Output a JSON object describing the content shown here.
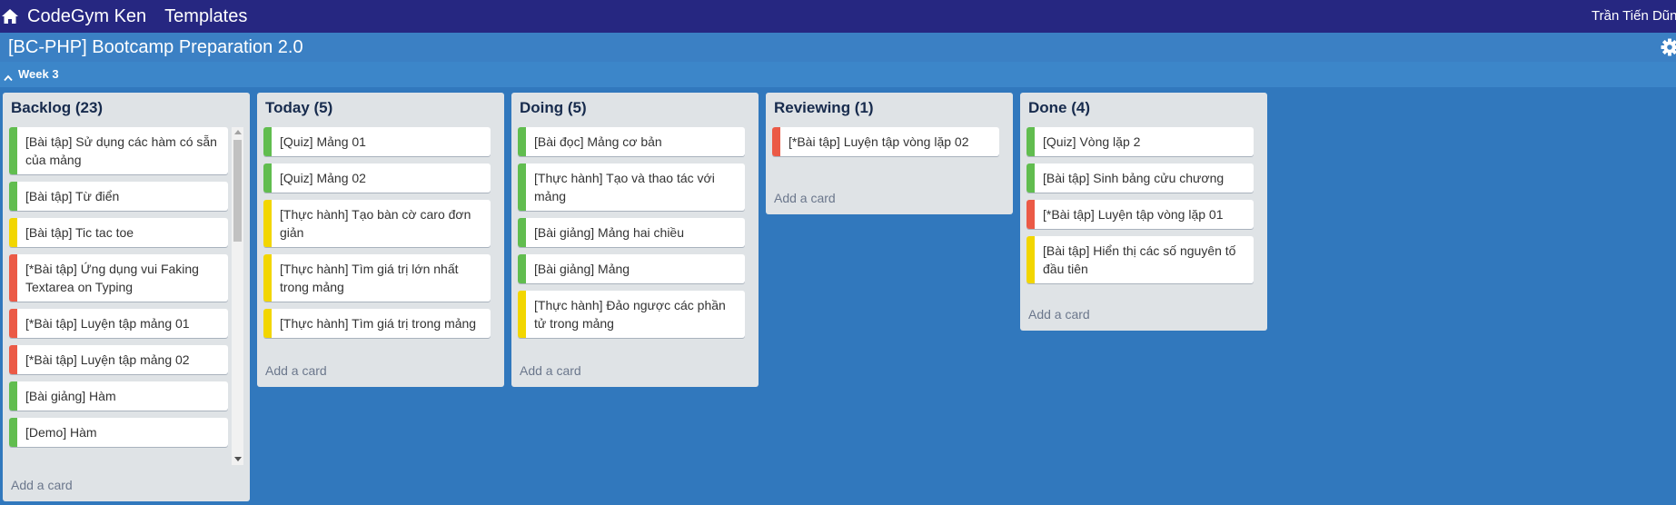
{
  "colors": {
    "green": "#61bd4f",
    "yellow": "#f2d600",
    "red": "#eb5a46"
  },
  "nav": {
    "home_icon": "home-icon",
    "brand": "CodeGym Ken",
    "templates": "Templates",
    "user": "Trần Tiến Dũng"
  },
  "board": {
    "title": "[BC-PHP] Bootcamp Preparation 2.0",
    "settings_icon": "gear-icon"
  },
  "week": {
    "label": "Week 3",
    "toggle_icon": "chevron-up-icon"
  },
  "lists": [
    {
      "title": "Backlog (23)",
      "add_card": "Add a card",
      "cards": [
        {
          "text": "[Bài tập] Sử dụng các hàm có sẵn của mảng",
          "label": "green"
        },
        {
          "text": "[Bài tập] Từ điển",
          "label": "green"
        },
        {
          "text": "[Bài tập] Tic tac toe",
          "label": "yellow"
        },
        {
          "text": "[*Bài tập] Ứng dụng vui Faking Textarea on Typing",
          "label": "red"
        },
        {
          "text": "[*Bài tập] Luyện tập mảng 01",
          "label": "red"
        },
        {
          "text": "[*Bài tập] Luyện tập mảng 02",
          "label": "red"
        },
        {
          "text": "[Bài giảng] Hàm",
          "label": "green"
        },
        {
          "text": "[Demo] Hàm",
          "label": "green"
        }
      ]
    },
    {
      "title": "Today (5)",
      "add_card": "Add a card",
      "cards": [
        {
          "text": "[Quiz] Mảng 01",
          "label": "green"
        },
        {
          "text": "[Quiz] Mảng 02",
          "label": "green"
        },
        {
          "text": "[Thực hành] Tạo bàn cờ caro đơn giản",
          "label": "yellow"
        },
        {
          "text": "[Thực hành] Tìm giá trị lớn nhất trong mảng",
          "label": "yellow"
        },
        {
          "text": "[Thực hành] Tìm giá trị trong mảng",
          "label": "yellow"
        }
      ]
    },
    {
      "title": "Doing (5)",
      "add_card": "Add a card",
      "cards": [
        {
          "text": "[Bài đọc] Mảng cơ bản",
          "label": "green"
        },
        {
          "text": "[Thực hành] Tạo và thao tác với mảng",
          "label": "green"
        },
        {
          "text": "[Bài giảng] Mảng hai chiều",
          "label": "green"
        },
        {
          "text": "[Bài giảng] Mảng",
          "label": "green"
        },
        {
          "text": "[Thực hành] Đảo ngược các phần tử trong mảng",
          "label": "yellow"
        }
      ]
    },
    {
      "title": "Reviewing (1)",
      "add_card": "Add a card",
      "cards": [
        {
          "text": "[*Bài tập] Luyện tập vòng lặp 02",
          "label": "red"
        }
      ]
    },
    {
      "title": "Done (4)",
      "add_card": "Add a card",
      "cards": [
        {
          "text": "[Quiz] Vòng lặp 2",
          "label": "green"
        },
        {
          "text": "[Bài tập] Sinh bảng cửu chương",
          "label": "green"
        },
        {
          "text": "[*Bài tập] Luyện tập vòng lặp 01",
          "label": "red"
        },
        {
          "text": "[Bài tập] Hiển thị các số nguyên tố đầu tiên",
          "label": "yellow"
        }
      ]
    }
  ]
}
